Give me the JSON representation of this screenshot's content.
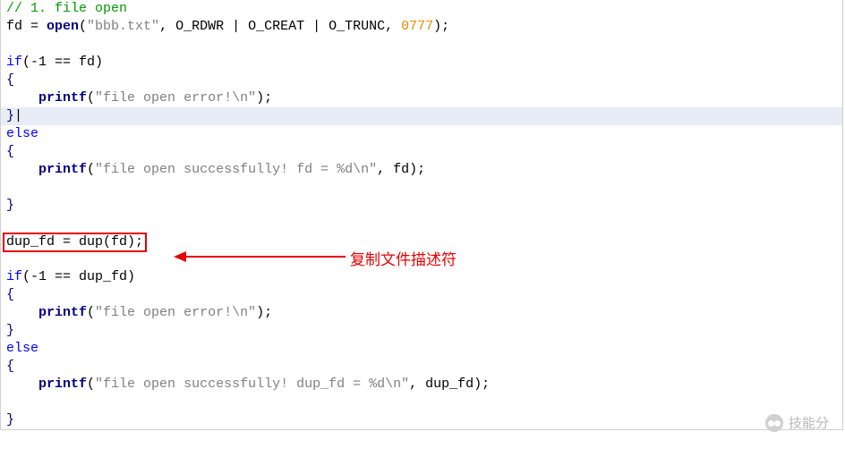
{
  "code": {
    "l1_comment": "// 1. file open",
    "l2_a": "fd = ",
    "l2_open": "open",
    "l2_paren": "(",
    "l2_str": "\"bbb.txt\"",
    "l2_b": ", O_RDWR | O_CREAT | O_TRUNC, ",
    "l2_num": "0777",
    "l2_end": ");",
    "l4_if": "if",
    "l4_cond": "(-1 == fd)",
    "l5_brace": "{",
    "l6_indent": "    ",
    "l6_printf": "printf",
    "l6_paren": "(",
    "l6_str": "\"file open error!\\n\"",
    "l6_end": ");",
    "l7_brace": "}",
    "l7_cursor": "|",
    "l8_else": "else",
    "l9_brace": "{",
    "l10_indent": "    ",
    "l10_printf": "printf",
    "l10_paren": "(",
    "l10_str": "\"file open successfully! fd = %d\\n\"",
    "l10_mid": ", fd);",
    "l12_brace": "}",
    "l14_dup": "dup_fd = dup(fd);",
    "l16_if": "if",
    "l16_cond": "(-1 == dup_fd)",
    "l17_brace": "{",
    "l18_indent": "    ",
    "l18_printf": "printf",
    "l18_paren": "(",
    "l18_str": "\"file open error!\\n\"",
    "l18_end": ");",
    "l19_brace": "}",
    "l20_else": "else",
    "l21_brace": "{",
    "l22_indent": "    ",
    "l22_printf": "printf",
    "l22_paren": "(",
    "l22_str": "\"file open successfully! dup_fd = %d\\n\"",
    "l22_mid": ", dup_fd);",
    "l24_brace": "}"
  },
  "annotation": "复制文件描述符",
  "watermark": "技能分"
}
